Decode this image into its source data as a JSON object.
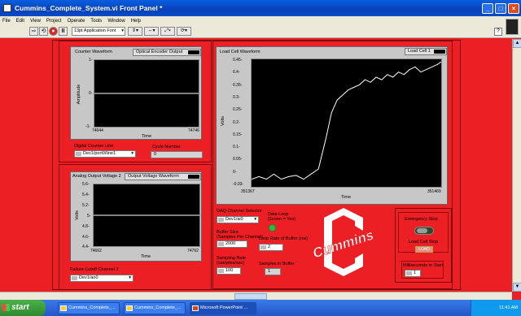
{
  "window": {
    "title": "Cummins_Complete_System.vi Front Panel *",
    "controls": [
      "_",
      "□",
      "×"
    ]
  },
  "menu": [
    "File",
    "Edit",
    "View",
    "Project",
    "Operate",
    "Tools",
    "Window",
    "Help"
  ],
  "toolbar": {
    "font": "13pt Application Font",
    "run_glyph": "⇨",
    "run_cont_glyph": "⟲",
    "stop_glyph": "●",
    "pause_glyph": "II",
    "align_glyph": "⇕▾",
    "distribute_glyph": "⇔▾",
    "resize_glyph": "⤢▾",
    "reorder_glyph": "⟳▾",
    "help_glyph": "?"
  },
  "counter": {
    "chart_title": "Counter Waveform",
    "legend": "Optical Encoder Output",
    "ylabel": "Amplitude",
    "xlabel": "Time",
    "y_ticks": [
      "1-",
      "0-",
      "-1-"
    ],
    "x_min": "74644",
    "x_max": "74746",
    "digital_line_label": "Digital Counter Line",
    "digital_line_value": "Dev1/port0/line1",
    "cycle_label": "Cycle  Number",
    "cycle_value": "0"
  },
  "voltage": {
    "chart_title": "Analog Output Voltage 2",
    "legend": "Output Voltage Waveform",
    "ylabel": "Volts",
    "xlabel": "Time",
    "y_ticks": [
      "5.6-",
      "5.4-",
      "5.2-",
      "5-",
      "4.8-",
      "4.6-",
      "4.4-"
    ],
    "x_min": "74662",
    "x_max": "74762",
    "failure_label": "Failure Cutoff Channel 2",
    "failure_value": "Dev1/ao0"
  },
  "loadcell": {
    "chart_title": "Load Cell Waveform",
    "legend": "Load Cell 1",
    "ylabel": "Volts",
    "xlabel": "Time",
    "y_ticks": [
      "0.45-",
      "0.4-",
      "0.35-",
      "0.3-",
      "0.25-",
      "0.2-",
      "0.15-",
      "0.1-",
      "0.05-",
      "0-",
      "-0.03-"
    ],
    "x_min": "351367",
    "x_max": "351469"
  },
  "daq": {
    "channel_label": "DAQ Channel Selector",
    "channel_value": "Dev1/ai0",
    "data_loop_label": "Data Loop\n(Green = Yes)",
    "buffer_label": "Buffer Size\n(Samples Per Channel)",
    "buffer_value": "2000",
    "loop_rate_label": "Loop Rate of Buffer (ms)",
    "loop_rate_value": "2",
    "sampling_label": "Sampling Rate\n(samples/sec)",
    "sampling_value": "100",
    "samples_label": "Samples in Buffer",
    "samples_value": "1"
  },
  "right_panel": {
    "emergency_label": "Emergency Stop",
    "load_cell_stop_label": "Load Cell Stop",
    "load_button": "LOAD",
    "ms_label": "Milliseconds to Start",
    "ms_value": "1"
  },
  "logo": {
    "text": "Cummins",
    "color": "#ffffff"
  },
  "taskbar": {
    "start": "start",
    "tasks": [
      "Cummins_Complete_...",
      "Cummins_Complete_...",
      "Microsoft PowerPoint ..."
    ],
    "clock": "11:41 AM"
  },
  "colors": {
    "background": "#ec1f25",
    "panel": "#c7c7c7",
    "plot": "#000000",
    "trace": "#ffffff",
    "led_on": "#2fbf2f"
  },
  "chart_data": [
    {
      "type": "line",
      "title": "Counter Waveform",
      "legend": [
        "Optical Encoder Output"
      ],
      "xlabel": "Time",
      "ylabel": "Amplitude",
      "xlim": [
        74644,
        74746
      ],
      "ylim": [
        -1,
        1
      ],
      "series": [
        {
          "name": "Optical Encoder Output",
          "x": [
            74644,
            74746
          ],
          "y": [
            0,
            0
          ]
        }
      ]
    },
    {
      "type": "line",
      "title": "Analog Output Voltage 2",
      "legend": [
        "Output Voltage Waveform"
      ],
      "xlabel": "Time",
      "ylabel": "Volts",
      "xlim": [
        74662,
        74762
      ],
      "ylim": [
        4.4,
        5.6
      ],
      "series": [
        {
          "name": "Output Voltage Waveform",
          "x": [
            74662,
            74762
          ],
          "y": [
            5,
            5
          ]
        }
      ]
    },
    {
      "type": "line",
      "title": "Load Cell Waveform",
      "legend": [
        "Load Cell 1"
      ],
      "xlabel": "Time",
      "ylabel": "Volts",
      "xlim": [
        351367,
        351469
      ],
      "ylim": [
        -0.03,
        0.47
      ],
      "series": [
        {
          "name": "Load Cell 1",
          "x": [
            351367,
            351371,
            351375,
            351379,
            351383,
            351387,
            351391,
            351395,
            351399,
            351403,
            351407,
            351410,
            351413,
            351416,
            351419,
            351422,
            351425,
            351428,
            351431,
            351434,
            351437,
            351440,
            351443,
            351446,
            351449,
            351452,
            351455,
            351458,
            351461,
            351464,
            351467,
            351469
          ],
          "y": [
            0.0,
            0.01,
            0.0,
            0.02,
            0.0,
            0.01,
            0.015,
            0.0,
            0.02,
            0.04,
            0.16,
            0.26,
            0.31,
            0.33,
            0.35,
            0.36,
            0.37,
            0.39,
            0.38,
            0.4,
            0.39,
            0.41,
            0.4,
            0.42,
            0.41,
            0.43,
            0.44,
            0.42,
            0.43,
            0.44,
            0.45,
            0.46
          ]
        }
      ]
    }
  ]
}
